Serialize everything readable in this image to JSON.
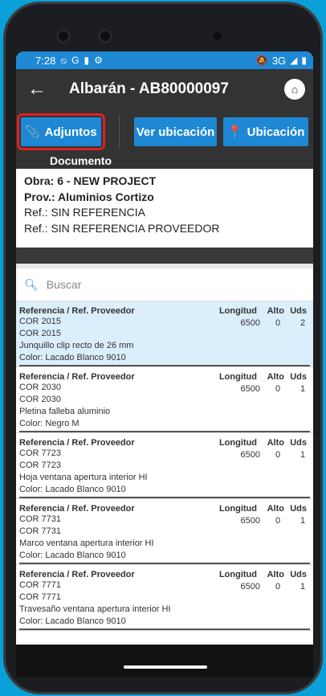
{
  "status": {
    "time": "7:28",
    "network": "3G"
  },
  "appbar": {
    "title": "Albarán - AB80000097"
  },
  "buttons": {
    "adjuntos": "Adjuntos",
    "ver_ubicacion": "Ver ubicación",
    "ubicacion": "Ubicación"
  },
  "document": {
    "header": "Documento",
    "obra": "Obra: 6 - NEW PROJECT",
    "prov": "Prov.: Aluminios Cortizo",
    "ref1": "Ref.: SIN REFERENCIA",
    "ref2": "Ref.: SIN REFERENCIA PROVEEDOR"
  },
  "search": {
    "placeholder": "Buscar"
  },
  "columns": {
    "ref": "Referencia / Ref. Proveedor",
    "longitud": "Longitud",
    "alto": "Alto",
    "uds": "Uds"
  },
  "items": [
    {
      "ref": "COR 2015",
      "ref_prov": "COR 2015",
      "desc": "Junquillo clip recto de 26 mm",
      "color": "Color: Lacado Blanco 9010",
      "longitud": "6500",
      "alto": "0",
      "uds": "2"
    },
    {
      "ref": "COR 2030",
      "ref_prov": "COR 2030",
      "desc": "Pletina falleba aluminio",
      "color": "Color: Negro M",
      "longitud": "6500",
      "alto": "0",
      "uds": "1"
    },
    {
      "ref": "COR 7723",
      "ref_prov": "COR 7723",
      "desc": "Hoja ventana apertura interior HI",
      "color": "Color: Lacado Blanco 9010",
      "longitud": "6500",
      "alto": "0",
      "uds": "1"
    },
    {
      "ref": "COR 7731",
      "ref_prov": "COR 7731",
      "desc": "Marco ventana apertura interior HI",
      "color": "Color: Lacado Blanco 9010",
      "longitud": "6500",
      "alto": "0",
      "uds": "1"
    },
    {
      "ref": "COR 7771",
      "ref_prov": "COR 7771",
      "desc": "Travesaño ventana apertura interior HI",
      "color": "Color: Lacado Blanco 9010",
      "longitud": "6500",
      "alto": "0",
      "uds": "1"
    }
  ],
  "colors": {
    "accent": "#1e88d4",
    "highlight": "#e02020",
    "appbar": "#333333"
  }
}
